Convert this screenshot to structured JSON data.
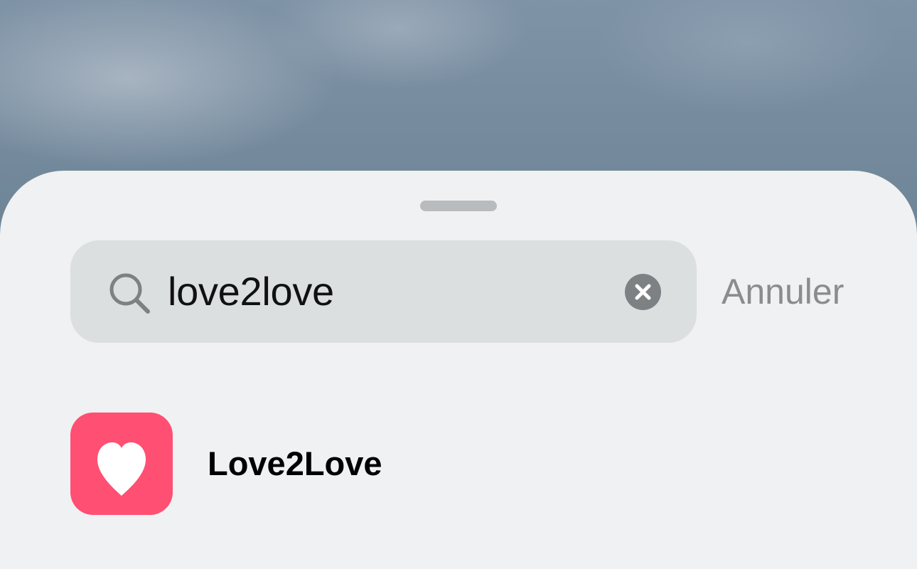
{
  "search": {
    "query": "love2love",
    "cancel_label": "Annuler"
  },
  "results": [
    {
      "name": "Love2Love",
      "icon": "heart-icon",
      "icon_color": "#ff4f73"
    }
  ],
  "colors": {
    "sheet_background": "#eff1f2",
    "search_field_background": "#dbdfe0",
    "cancel_text": "#8a8d90"
  }
}
